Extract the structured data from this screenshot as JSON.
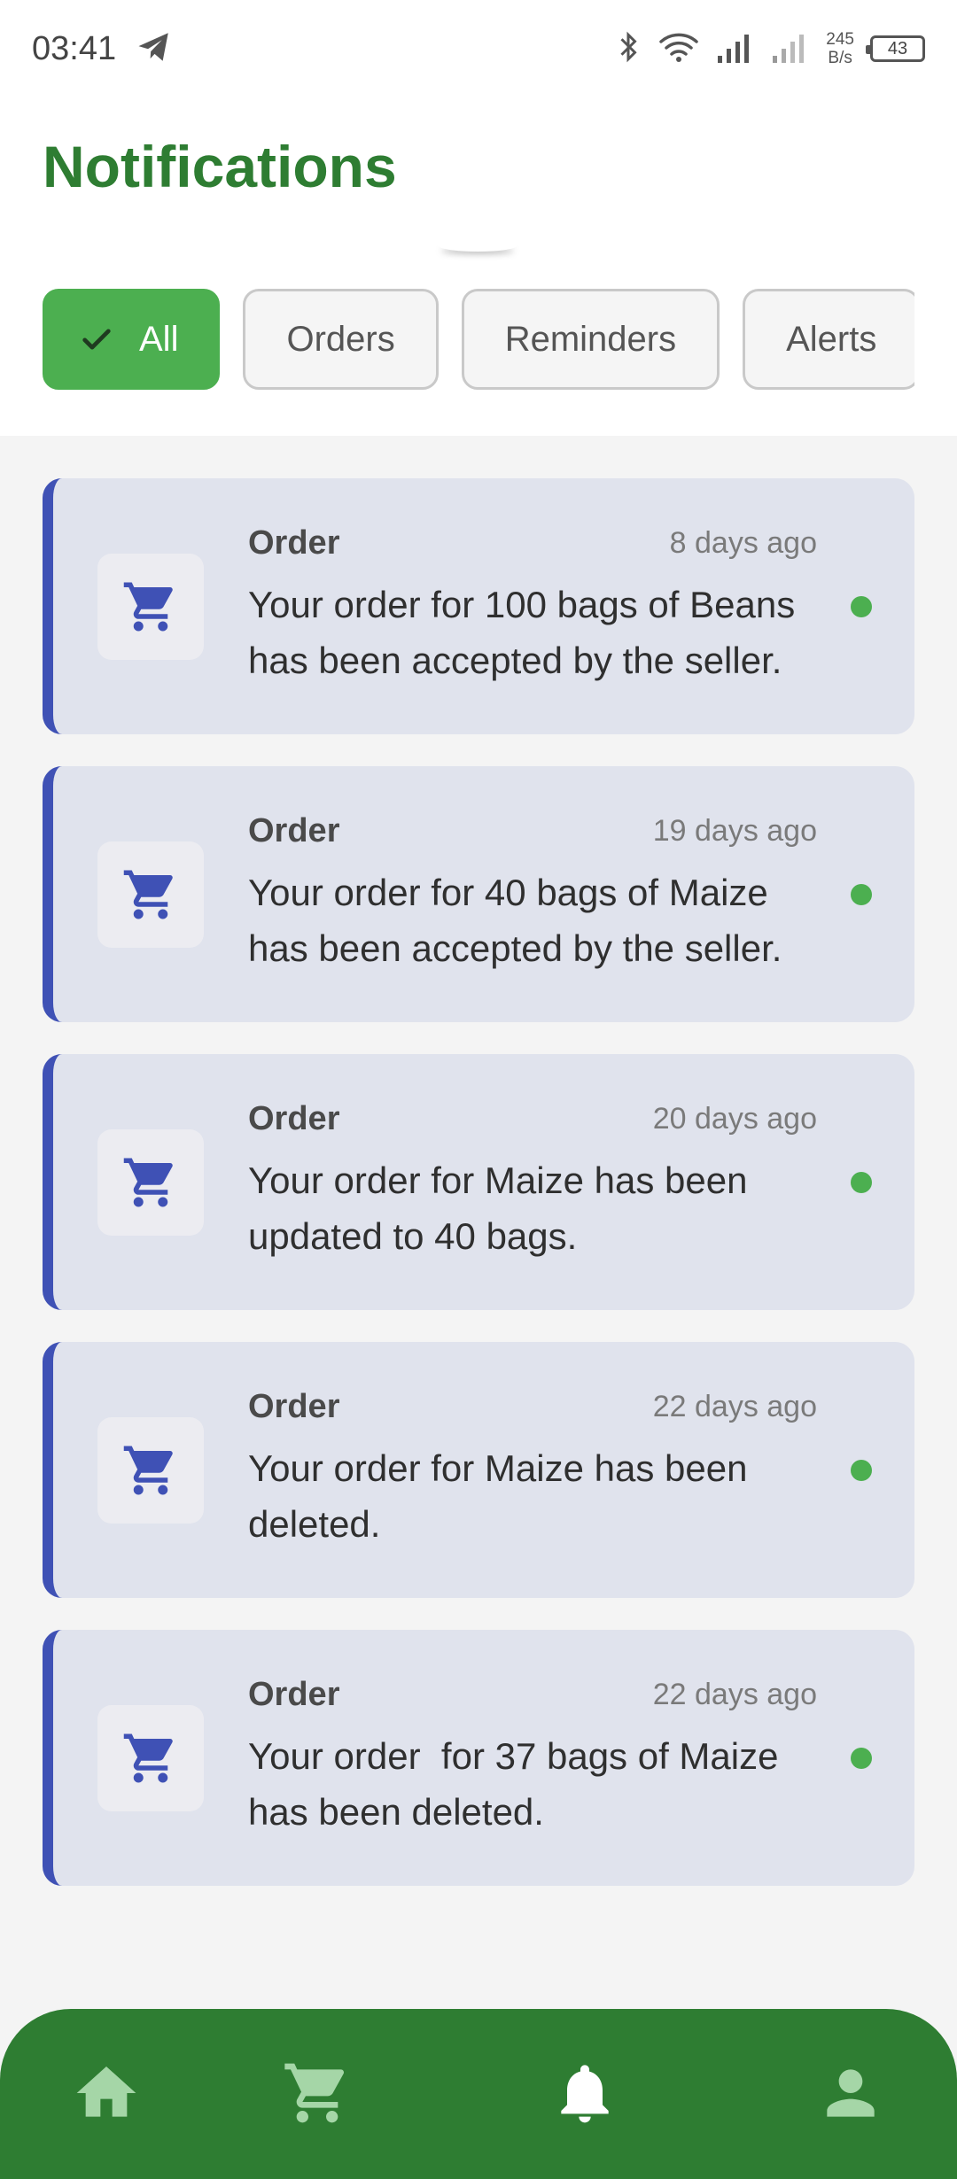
{
  "status_bar": {
    "time": "03:41",
    "net_speed_value": "245",
    "net_speed_unit": "B/s",
    "battery": "43"
  },
  "header": {
    "title": "Notifications"
  },
  "filters": [
    {
      "label": "All",
      "active": true
    },
    {
      "label": "Orders",
      "active": false
    },
    {
      "label": "Reminders",
      "active": false
    },
    {
      "label": "Alerts",
      "active": false
    }
  ],
  "notifications": [
    {
      "type": "Order",
      "time": "8 days ago",
      "message": "Your order for 100 bags of Beans has been accepted by the seller.",
      "unread": true,
      "icon": "cart-icon"
    },
    {
      "type": "Order",
      "time": "19 days ago",
      "message": "Your order for 40 bags of Maize has been accepted by the seller.",
      "unread": true,
      "icon": "cart-icon"
    },
    {
      "type": "Order",
      "time": "20 days ago",
      "message": "Your order for Maize has been updated to 40 bags.",
      "unread": true,
      "icon": "cart-icon"
    },
    {
      "type": "Order",
      "time": "22 days ago",
      "message": "Your order for Maize has been deleted.",
      "unread": true,
      "icon": "cart-icon"
    },
    {
      "type": "Order",
      "time": "22 days ago",
      "message": "Your order  for 37 bags of Maize has been deleted.",
      "unread": true,
      "icon": "cart-icon"
    }
  ],
  "bottom_nav": [
    {
      "icon": "home-icon",
      "active": false
    },
    {
      "icon": "cart-icon",
      "active": false
    },
    {
      "icon": "bell-icon",
      "active": true
    },
    {
      "icon": "person-icon",
      "active": false
    }
  ],
  "colors": {
    "brand_green": "#2e7d32",
    "chip_active": "#4caf50",
    "accent_blue": "#3f51b5",
    "card_bg": "#e0e3ed",
    "unread_dot": "#4caf50"
  }
}
